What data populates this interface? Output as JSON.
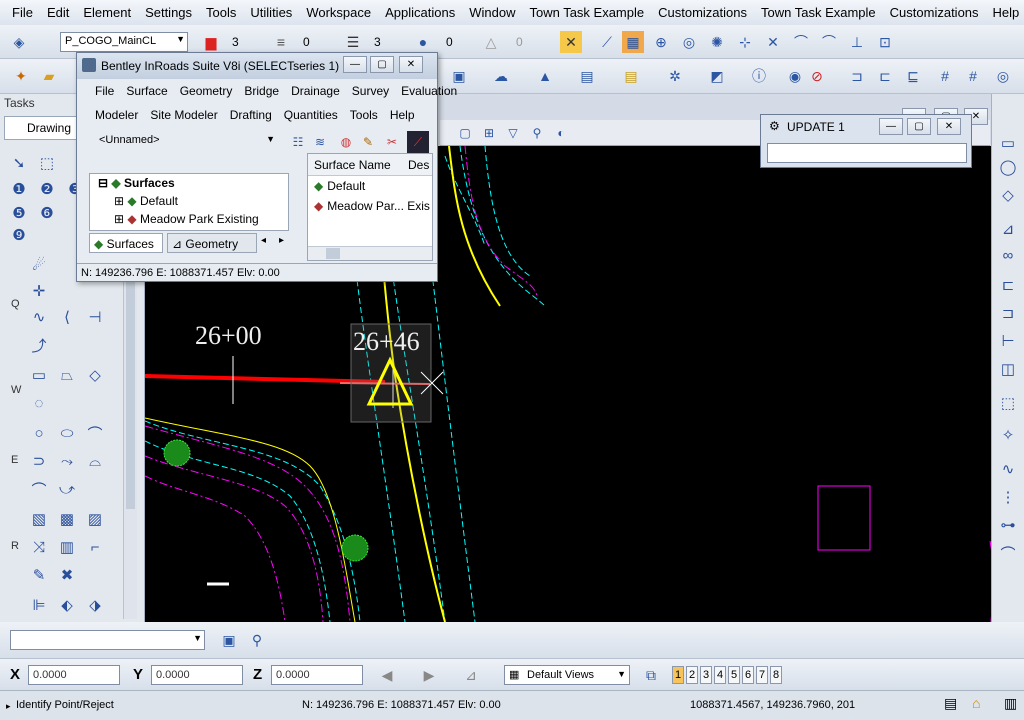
{
  "menubar": [
    "File",
    "Edit",
    "Element",
    "Settings",
    "Tools",
    "Utilities",
    "Workspace",
    "Applications",
    "Window",
    "Town Task Example",
    "Customizations",
    "Town Task Example",
    "Customizations",
    "Help"
  ],
  "toolbar": {
    "level_combo": "P_COGO_MainCL",
    "color_value": "3",
    "style_value": "0",
    "weight_value": "3",
    "transparency_value": "0",
    "priority_value": "0"
  },
  "tasks": {
    "title": "Tasks",
    "tab": "Drawing",
    "row_letters": [
      "Q",
      "W",
      "E",
      "R"
    ]
  },
  "inroads": {
    "title": "Bentley InRoads Suite V8i (SELECTseries 1)",
    "menu1": [
      "File",
      "Surface",
      "Geometry",
      "Bridge",
      "Drainage",
      "Survey",
      "Evaluation"
    ],
    "menu2": [
      "Modeler",
      "Site Modeler",
      "Drafting",
      "Quantities",
      "Tools",
      "Help"
    ],
    "combo": "<Unnamed>",
    "tree": {
      "root": "Surfaces",
      "items": [
        "Default",
        "Meadow Park Existing"
      ]
    },
    "tabs": [
      "Surfaces",
      "Geometry"
    ],
    "list": {
      "headers": [
        "Surface Name",
        "Des"
      ],
      "rows": [
        {
          "name": "Default",
          "desc": ""
        },
        {
          "name": "Meadow Par...",
          "desc": "Exis"
        }
      ]
    },
    "status": "N: 149236.796 E: 1088371.457 Elv: 0.00"
  },
  "update_window": {
    "title": "UPDATE 1"
  },
  "canvas": {
    "station_1": "26+00",
    "station_2": "26+46"
  },
  "coords": {
    "x_label": "X",
    "x_value": "0.0000",
    "y_label": "Y",
    "y_value": "0.0000",
    "z_label": "Z",
    "z_value": "0.0000",
    "views_combo": "Default Views",
    "view_numbers": [
      "1",
      "2",
      "3",
      "4",
      "5",
      "6",
      "7",
      "8"
    ]
  },
  "statusbar": {
    "prompt": "Identify Point/Reject",
    "coords": "N: 149236.796 E: 1088371.457 Elv: 0.00",
    "right": "1088371.4567, 149236.7960, 201"
  },
  "colors": {
    "canvas_bg": "#000000",
    "alignment": "#ff0000",
    "edge_of_road": "#ffff00",
    "contours": "#ff00ff",
    "cyan_lines": "#00ffff",
    "trees": "#22cc22"
  }
}
